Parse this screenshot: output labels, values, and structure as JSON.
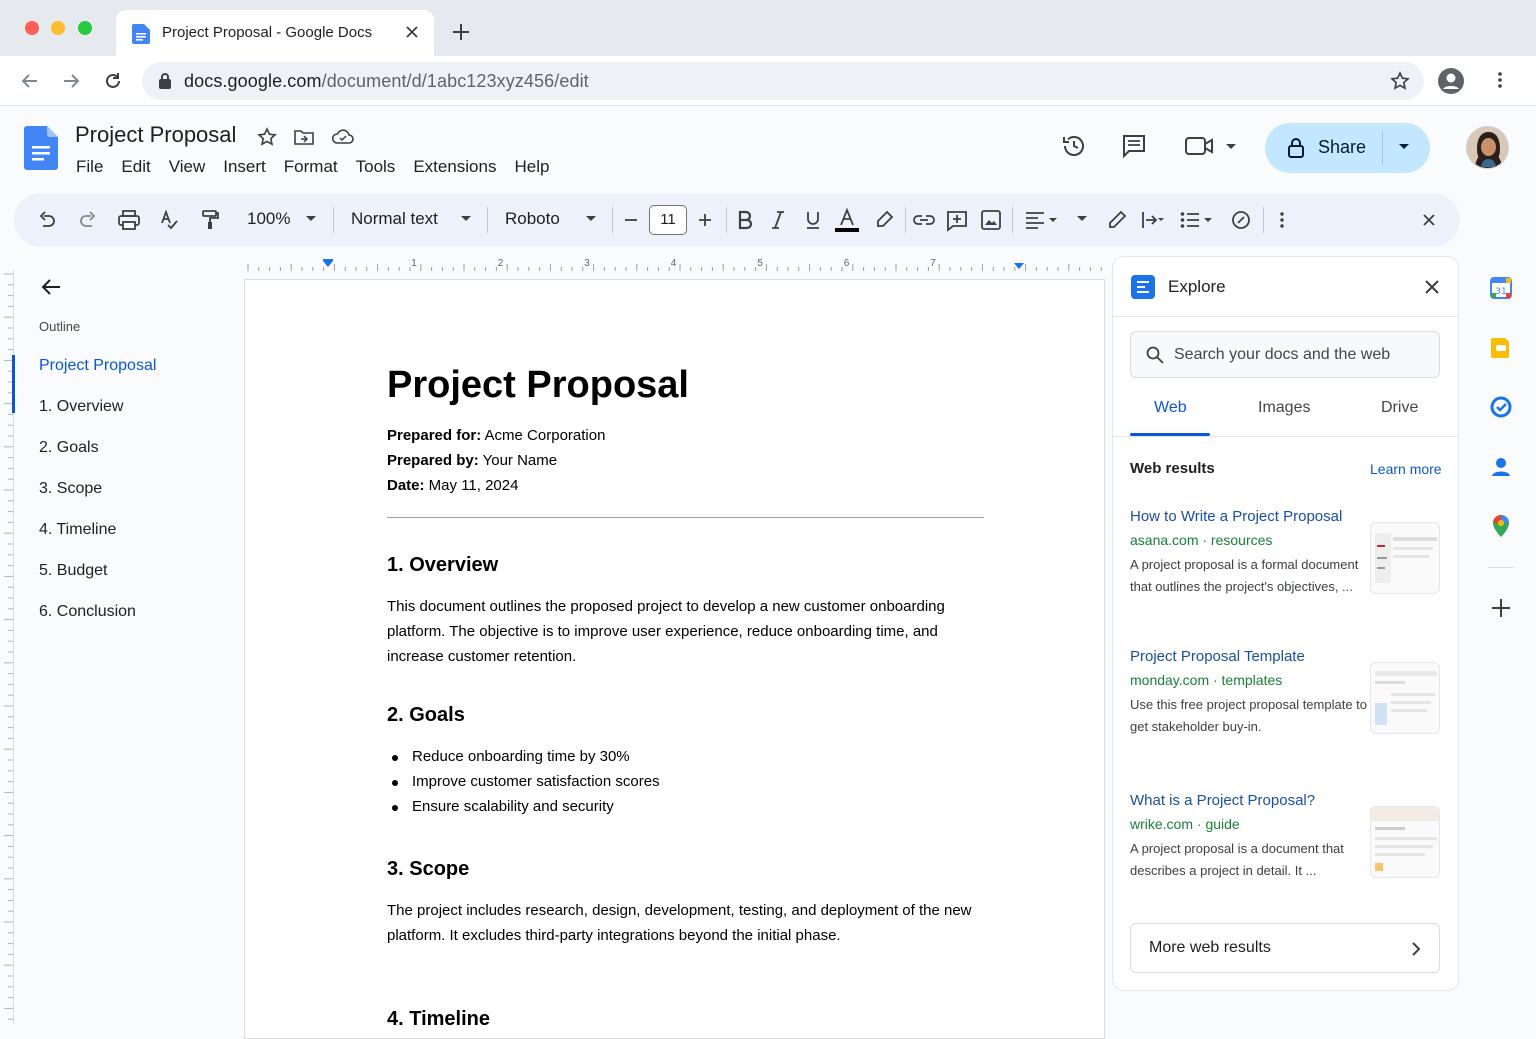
{
  "browser": {
    "tab_title": "Project Proposal - Google Docs",
    "url_host": "docs.google.com",
    "url_path": "/document/d/1abc123xyz456/edit"
  },
  "doc_header": {
    "title": "Project Proposal",
    "menu": [
      "File",
      "Edit",
      "View",
      "Insert",
      "Format",
      "Tools",
      "Extensions",
      "Help"
    ],
    "share_label": "Share"
  },
  "toolbar": {
    "zoom": "100%",
    "style": "Normal text",
    "font": "Roboto",
    "font_size": "11"
  },
  "outline": {
    "label": "Outline",
    "items": [
      "Project Proposal",
      "1. Overview",
      "2. Goals",
      "3. Scope",
      "4. Timeline",
      "5. Budget",
      "6. Conclusion"
    ],
    "active_index": 0
  },
  "document": {
    "title": "Project Proposal",
    "prepared_for_label": "Prepared for:",
    "prepared_for": " Acme Corporation",
    "prepared_by_label": "Prepared by:",
    "prepared_by": " Your Name",
    "date_label": "Date:",
    "date": " May 11, 2024",
    "sections": {
      "overview_heading": "1. Overview",
      "overview_text": "This document outlines the proposed project to develop a new customer onboarding platform. The objective is to improve user experience, reduce onboarding time, and increase customer retention.",
      "goals_heading": "2. Goals",
      "goals": [
        "Reduce onboarding time by 30%",
        "Improve customer satisfaction scores",
        "Ensure scalability and security"
      ],
      "scope_heading": "3. Scope",
      "scope_text": "The project includes research, design, development, testing, and deployment of the new platform. It excludes third-party integrations beyond the initial phase.",
      "timeline_heading": "4. Timeline"
    }
  },
  "ruler": {
    "numbers": [
      "1",
      "2",
      "3",
      "4",
      "5",
      "6",
      "7"
    ]
  },
  "explore": {
    "title": "Explore",
    "search_placeholder": "Search your docs and the web",
    "tabs": [
      "Web",
      "Images",
      "Drive"
    ],
    "active_tab": "Web",
    "web_results_label": "Web results",
    "learn_more": "Learn more",
    "results": [
      {
        "title": "How to Write a Project Proposal",
        "source": "asana.com · resources",
        "snippet": "A project proposal is a formal document that outlines the project's objectives, ..."
      },
      {
        "title": "Project Proposal Template",
        "source": "monday.com · templates",
        "snippet": "Use this free project proposal template to get stakeholder buy-in."
      },
      {
        "title": "What is a Project Proposal?",
        "source": "wrike.com · guide",
        "snippet": "A project proposal is a document that describes a project in detail. It ..."
      }
    ],
    "more_results": "More web results"
  },
  "colors": {
    "accent": "#0b57d0",
    "share_bg": "#c2e7ff",
    "toolbar_bg": "#edf2fa",
    "link_green": "#188038"
  }
}
